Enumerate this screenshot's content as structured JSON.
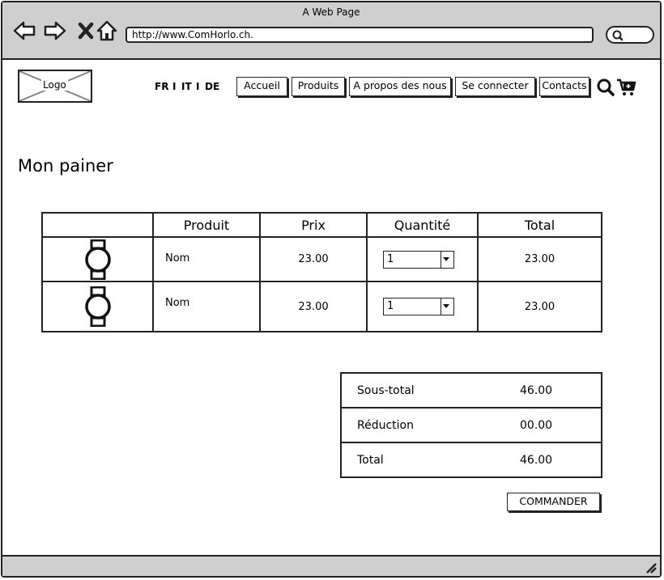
{
  "browser": {
    "window_title": "A Web Page",
    "url": "http://www.ComHorlo.ch."
  },
  "header": {
    "logo_label": "Logo",
    "languages": [
      "FR",
      "IT",
      "DE"
    ],
    "separators": [
      "I",
      "I"
    ],
    "menu": [
      "Accueil",
      "Produits",
      "A propos des nous",
      "Se connecter",
      "Contacts"
    ]
  },
  "page": {
    "title": "Mon painer"
  },
  "cart": {
    "columns": [
      "",
      "Produit",
      "Prix",
      "Quantité",
      "Total"
    ],
    "rows": [
      {
        "product": "Nom",
        "price": "23.00",
        "quantity": "1",
        "total": "23.00"
      },
      {
        "product": "Nom",
        "price": "23.00",
        "quantity": "1",
        "total": "23.00"
      }
    ]
  },
  "summary": {
    "subtotal_label": "Sous-total",
    "subtotal_value": "46.00",
    "discount_label": "Réduction",
    "discount_value": "00.00",
    "total_label": "Total",
    "total_value": "46.00"
  },
  "actions": {
    "order_label": "COMMANDER"
  }
}
